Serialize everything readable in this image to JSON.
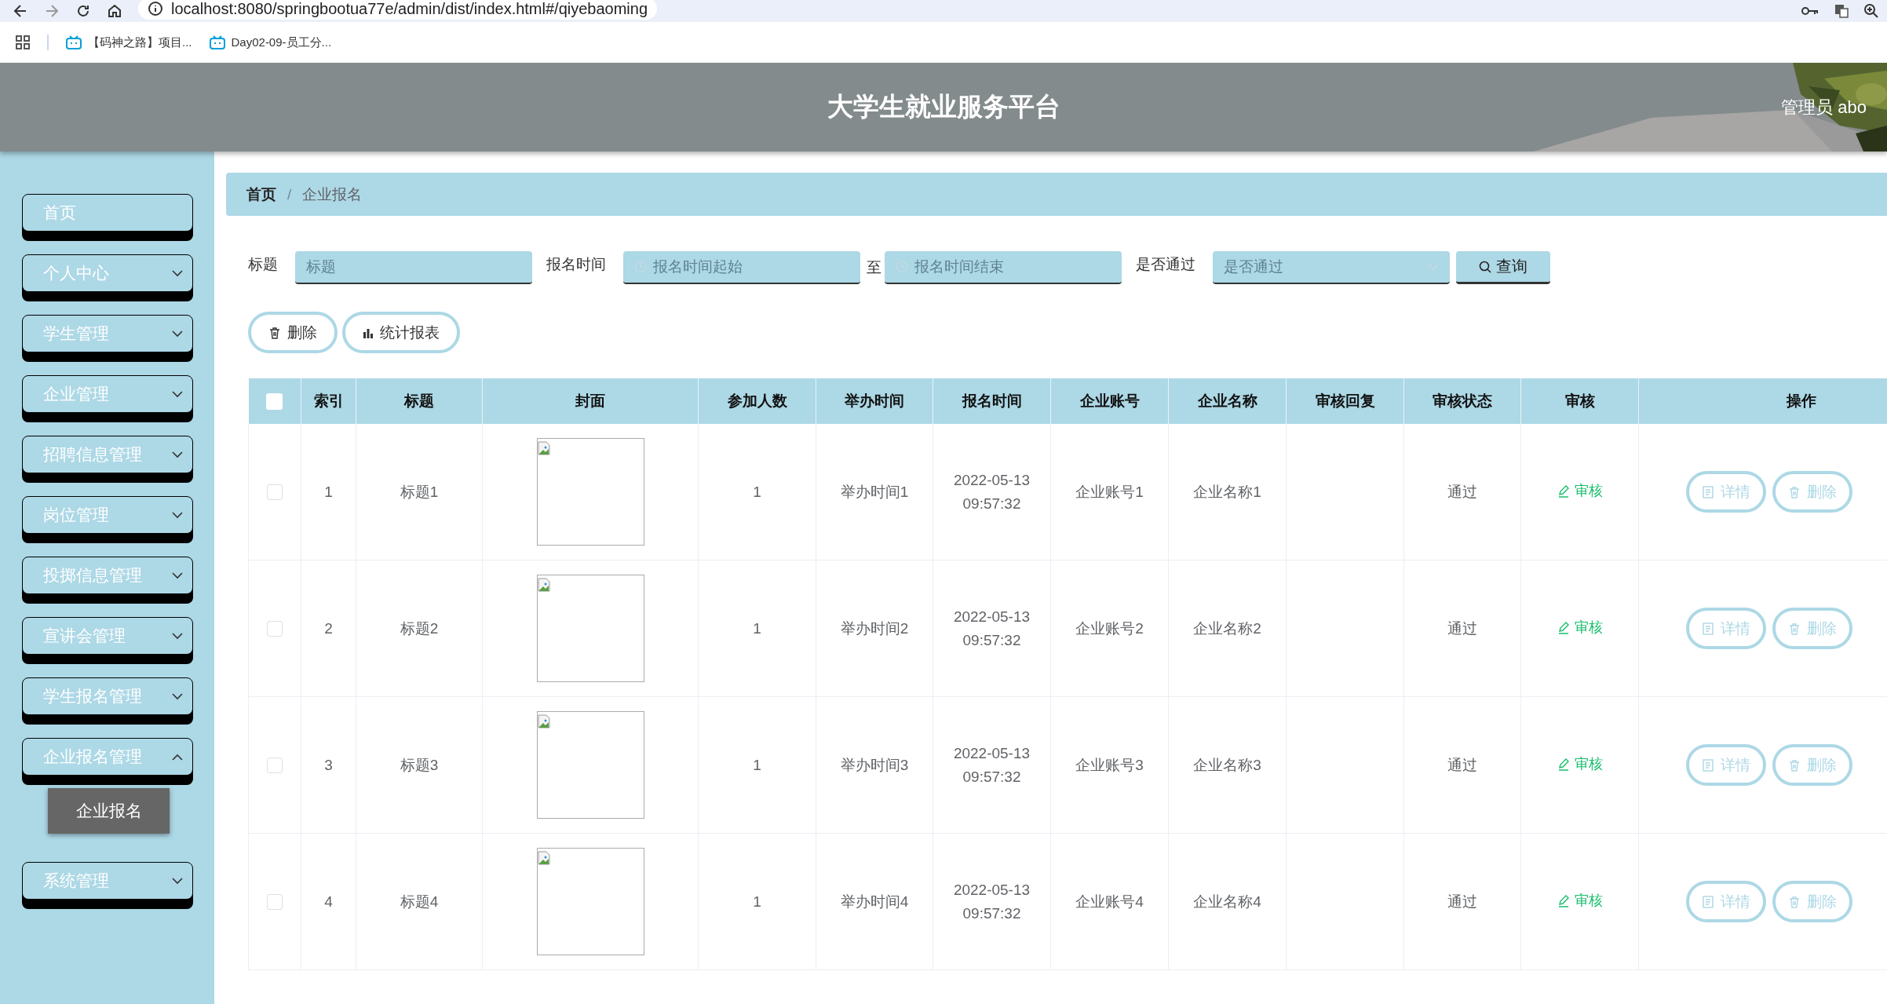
{
  "browser": {
    "url": "localhost:8080/springbootua77e/admin/dist/index.html#/qiyebaoming",
    "bookmarks": [
      "【码神之路】项目...",
      "Day02-09-员工分..."
    ]
  },
  "header": {
    "title": "大学生就业服务平台",
    "user": "管理员 abo"
  },
  "sidebar": {
    "items": [
      {
        "label": "首页",
        "kind": "link"
      },
      {
        "label": "个人中心",
        "kind": "submenu",
        "expanded": false
      },
      {
        "label": "学生管理",
        "kind": "submenu",
        "expanded": false
      },
      {
        "label": "企业管理",
        "kind": "submenu",
        "expanded": false
      },
      {
        "label": "招聘信息管理",
        "kind": "submenu",
        "expanded": false
      },
      {
        "label": "岗位管理",
        "kind": "submenu",
        "expanded": false
      },
      {
        "label": "投掷信息管理",
        "kind": "submenu",
        "expanded": false
      },
      {
        "label": "宣讲会管理",
        "kind": "submenu",
        "expanded": false
      },
      {
        "label": "学生报名管理",
        "kind": "submenu",
        "expanded": false
      },
      {
        "label": "企业报名管理",
        "kind": "submenu",
        "expanded": true,
        "children": [
          {
            "label": "企业报名",
            "selected": true
          }
        ]
      },
      {
        "label": "系统管理",
        "kind": "submenu",
        "expanded": false
      }
    ]
  },
  "breadcrumb": [
    "首页",
    "企业报名"
  ],
  "breadcrumb_separator": "/",
  "search": {
    "fields": [
      {
        "label": "标题",
        "kind": "text",
        "placeholder": "标题"
      },
      {
        "label": "报名时间",
        "kind": "date",
        "placeholder": "报名时间起始"
      },
      {
        "label": "至",
        "kind": "date",
        "placeholder": "报名时间结束"
      },
      {
        "label": "是否通过",
        "kind": "select",
        "placeholder": "是否通过"
      }
    ],
    "button": "查询"
  },
  "actions": [
    {
      "label": "删除",
      "kind": "delete"
    },
    {
      "label": "统计报表",
      "kind": "chart"
    }
  ],
  "table": {
    "select_all": false,
    "columns": [
      "索引",
      "标题",
      "封面",
      "参加人数",
      "举办时间",
      "报名时间",
      "企业账号",
      "企业名称",
      "审核回复",
      "审核状态",
      "审核",
      "操作"
    ],
    "rows": [
      {
        "checked": false,
        "index": "1",
        "title": "标题1",
        "participants": "1",
        "held_time": "举办时间1",
        "signup_time": "2022-05-13 09:57:32",
        "account": "企业账号1",
        "company": "企业名称1",
        "status": "通过",
        "review": "审核",
        "ops": [
          "详情",
          "删除"
        ]
      },
      {
        "checked": false,
        "index": "2",
        "title": "标题2",
        "participants": "1",
        "held_time": "举办时间2",
        "signup_time": "2022-05-13 09:57:32",
        "account": "企业账号2",
        "company": "企业名称2",
        "status": "通过",
        "review": "审核",
        "ops": [
          "详情",
          "删除"
        ]
      },
      {
        "checked": false,
        "index": "3",
        "title": "标题3",
        "participants": "1",
        "held_time": "举办时间3",
        "signup_time": "2022-05-13 09:57:32",
        "account": "企业账号3",
        "company": "企业名称3",
        "status": "通过",
        "review": "审核",
        "ops": [
          "详情",
          "删除"
        ]
      },
      {
        "checked": false,
        "index": "4",
        "title": "标题4",
        "participants": "1",
        "held_time": "举办时间4",
        "signup_time": "2022-05-13 09:57:32",
        "account": "企业账号4",
        "company": "企业名称4",
        "status": "通过",
        "review": "审核",
        "ops": [
          "详情",
          "删除"
        ]
      }
    ]
  }
}
